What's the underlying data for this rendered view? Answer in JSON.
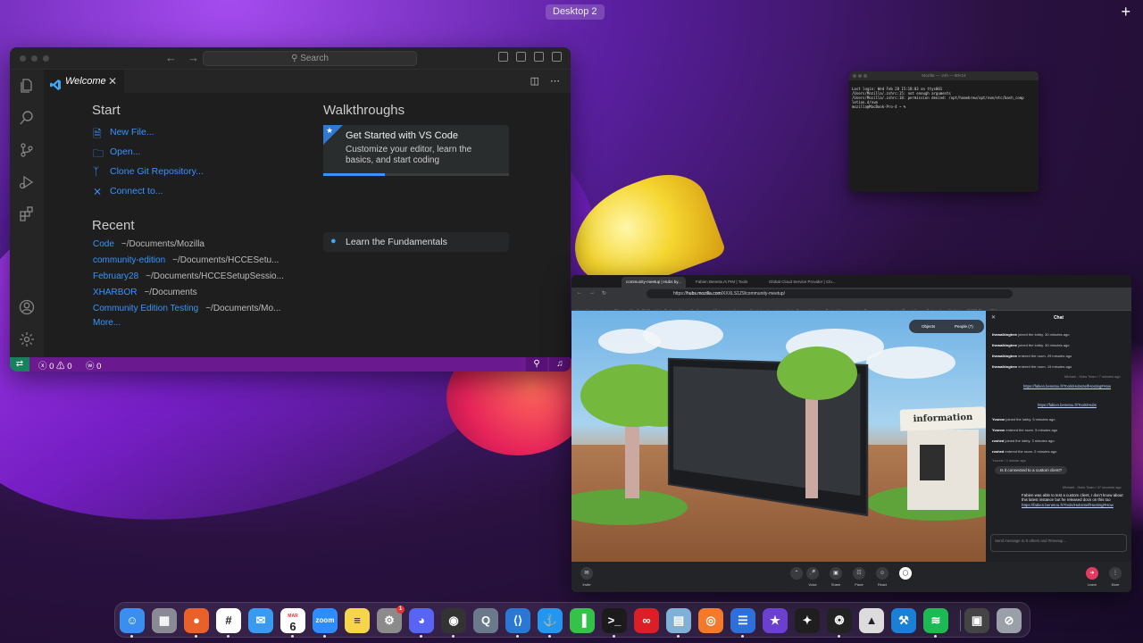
{
  "menubar": {
    "desktop_label": "Desktop 2",
    "add_label": "+"
  },
  "vscode": {
    "search_placeholder": "Search",
    "tab_label": "Welcome",
    "start_heading": "Start",
    "start_items": [
      {
        "label": "New File...",
        "icon": "new-file-icon"
      },
      {
        "label": "Open...",
        "icon": "folder-open-icon"
      },
      {
        "label": "Clone Git Repository...",
        "icon": "git-branch-icon"
      },
      {
        "label": "Connect to...",
        "icon": "remote-connect-icon"
      }
    ],
    "recent_heading": "Recent",
    "recent_items": [
      {
        "name": "Code",
        "path": "~/Documents/Mozilla"
      },
      {
        "name": "community-edition",
        "path": "~/Documents/HCCESetu..."
      },
      {
        "name": "February28",
        "path": "~/Documents/HCCESetupSessio..."
      },
      {
        "name": "XHARBOR",
        "path": "~/Documents"
      },
      {
        "name": "Community Edition Testing",
        "path": "~/Documents/Mo..."
      }
    ],
    "more_label": "More...",
    "walkthroughs_heading": "Walkthroughs",
    "walkthrough_featured": {
      "title": "Get Started with VS Code",
      "description": "Customize your editor, learn the basics, and start coding",
      "progress": 0.33
    },
    "walkthrough_second": "Learn the Fundamentals",
    "status": {
      "problems": "ⓧ 0 ⚠ 0",
      "ports": "ⓦ 0"
    },
    "accent_color": "#6a1a8e"
  },
  "terminal": {
    "title": "Mozilla — -zsh — 80×24",
    "lines": [
      "Last login: Wed Feb 28 15:18:03 on ttys001",
      "/Users/Mozilla/.zshrc:15: not enough arguments",
      "/Users/Mozilla/.zshrc:18: permission denied: /opt/homebrew/opt/nvm/etc/bash_comp",
      "letion.d/nvm",
      "mozilla@MacBook-Pro-4 ~ %"
    ]
  },
  "browser": {
    "tabs": [
      "community-meetup | Hubs by...",
      "Fabien Benetou's PIM | Tools",
      "Global Cloud Service Provider | Clo..."
    ],
    "url_prefix": "https://",
    "url_host": "hubs.mozilla.com",
    "url_path": "/XXXLS1Z9/community-meetup/",
    "bookmarks": [
      "Import bookmarks...",
      "GitLab",
      "Mozilla BIAS",
      "Hubs Trello",
      "Hubs - Confluence",
      "Welcome to Hubs...",
      "My Hub",
      "Learning",
      "Hubs Demo - Hubs...",
      "Project Management",
      "Resources",
      "Important Translatio...",
      "Onboarding with Hubs",
      "BMAD Discord Set..."
    ],
    "scene_sign": "information",
    "scene_objects": "Objects",
    "scene_people": "People (7)",
    "chat": {
      "title": "Chat",
      "events": [
        {
          "user": "thewalkingtree",
          "text": "joined the lobby.",
          "time": "30 minutes ago"
        },
        {
          "user": "thewalkingtree",
          "text": "joined the lobby.",
          "time": "30 minutes ago"
        },
        {
          "user": "thewalkingtree",
          "text": "entered the room.",
          "time": "29 minutes ago"
        },
        {
          "user": "thewalkingtree",
          "text": "entered the room.",
          "time": "19 minutes ago"
        }
      ],
      "msg_meta": "Michael - Hubs Team / 7 minutes ago",
      "link1": "https://fabien.benetou.fr/Tools/HubsSelfHosting#How",
      "link2": "https://fabien.benetou.fr/Tools/Hubs",
      "events2": [
        {
          "user": "Yvonne",
          "text": "joined the lobby.",
          "time": "5 minutes ago"
        },
        {
          "user": "Yvonne",
          "text": "entered the room.",
          "time": "5 minutes ago"
        },
        {
          "user": "roshed",
          "text": "joined the lobby.",
          "time": "3 minutes ago"
        },
        {
          "user": "roshed",
          "text": "entered the room.",
          "time": "2 minutes ago"
        }
      ],
      "question_meta": "Yvonne / 1 minute ago",
      "question": "Is it connected to a custom client?",
      "reply_meta": "Michael - Hubs Team / 47 seconds ago",
      "reply": "Fabien was able to test a custom client, I don't know about this latest instance but he released docs on this too",
      "reply_link": "https://fabien.benetou.fr/Tools/HubsSelfHosting#How",
      "input_placeholder": "Send message to 8 others and #meetup..."
    },
    "bottom": {
      "invite": "Invite",
      "voice": "Voice",
      "share": "Share",
      "place": "Place",
      "react": "React",
      "leave": "Leave",
      "more": "More"
    }
  },
  "dock": {
    "apps": [
      {
        "name": "finder-icon",
        "glyph": "☺",
        "color": "#3a8ef0"
      },
      {
        "name": "launchpad-icon",
        "glyph": "▦",
        "color": "#8a8a95"
      },
      {
        "name": "firefox-icon",
        "glyph": "●",
        "color": "#e8602a"
      },
      {
        "name": "slack-icon",
        "glyph": "#",
        "color": "#ffffff"
      },
      {
        "name": "mail-icon",
        "glyph": "✉",
        "color": "#3a9af2"
      },
      {
        "name": "calendar-icon",
        "glyph": "6",
        "color": "#ffffff"
      },
      {
        "name": "zoom-icon",
        "glyph": "zoom",
        "color": "#2d8cff"
      },
      {
        "name": "notes-icon",
        "glyph": "≡",
        "color": "#f7d54a"
      },
      {
        "name": "system-settings-icon",
        "glyph": "⚙",
        "color": "#8b8b8b"
      },
      {
        "name": "discord-icon",
        "glyph": "◕",
        "color": "#5865f2"
      },
      {
        "name": "obs-icon",
        "glyph": "◉",
        "color": "#333333"
      },
      {
        "name": "quicktime-icon",
        "glyph": "Q",
        "color": "#6a7a8c"
      },
      {
        "name": "vscode-icon",
        "glyph": "⟨⟩",
        "color": "#2a78d3"
      },
      {
        "name": "docker-icon",
        "glyph": "⚓",
        "color": "#2496ed"
      },
      {
        "name": "numbers-icon",
        "glyph": "▐",
        "color": "#34c24a"
      },
      {
        "name": "terminal-icon",
        "glyph": ">_",
        "color": "#1b1b1b"
      },
      {
        "name": "creative-cloud-icon",
        "glyph": "∞",
        "color": "#da1f26"
      },
      {
        "name": "preview-icon",
        "glyph": "▤",
        "color": "#7fb0d8"
      },
      {
        "name": "blender-icon",
        "glyph": "◎",
        "color": "#f5792a"
      },
      {
        "name": "tableplus-icon",
        "glyph": "☰",
        "color": "#2e6fd9"
      },
      {
        "name": "imovie-icon",
        "glyph": "★",
        "color": "#6b3fd0"
      },
      {
        "name": "figma-icon",
        "glyph": "✦",
        "color": "#1e1e1e"
      },
      {
        "name": "unity-icon",
        "glyph": "❂",
        "color": "#222222"
      },
      {
        "name": "sequel-pro-icon",
        "glyph": "▲",
        "color": "#dcdcdc"
      },
      {
        "name": "xcode-icon",
        "glyph": "⚒",
        "color": "#1c7fd6"
      },
      {
        "name": "spotify-icon",
        "glyph": "≋",
        "color": "#1db954"
      },
      {
        "name": "screenshot-icon",
        "glyph": "▣",
        "color": "#444444"
      },
      {
        "name": "trash-icon",
        "glyph": "⊘",
        "color": "#9aa0a8"
      }
    ],
    "calendar_month": "MAR",
    "calendar_day": "6",
    "settings_badge": "1"
  }
}
